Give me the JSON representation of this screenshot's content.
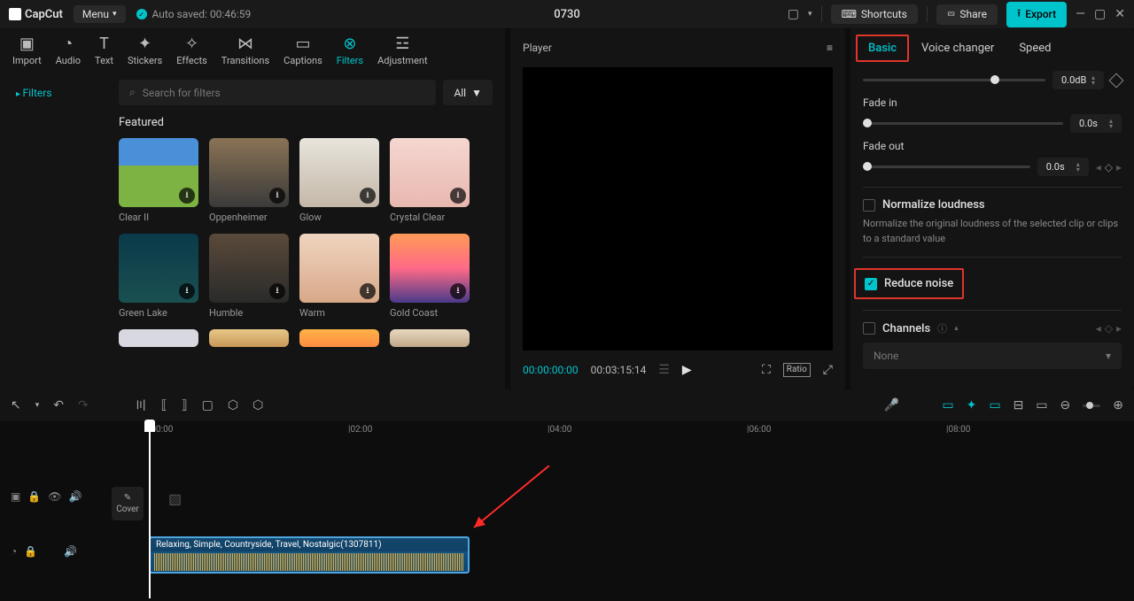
{
  "topbar": {
    "brand": "CapCut",
    "menu": "Menu",
    "autosave": "Auto saved: 00:46:59",
    "project": "0730",
    "shortcuts": "Shortcuts",
    "share": "Share",
    "export": "Export"
  },
  "media_tabs": {
    "import": "Import",
    "audio": "Audio",
    "text": "Text",
    "stickers": "Stickers",
    "effects": "Effects",
    "transitions": "Transitions",
    "captions": "Captions",
    "filters": "Filters",
    "adjustment": "Adjustment"
  },
  "filters_panel": {
    "sidebar_item": "Filters",
    "search_placeholder": "Search for filters",
    "all_btn": "All",
    "section": "Featured",
    "thumbs": [
      {
        "label": "Clear II"
      },
      {
        "label": "Oppenheimer"
      },
      {
        "label": "Glow"
      },
      {
        "label": "Crystal Clear"
      },
      {
        "label": "Green Lake"
      },
      {
        "label": "Humble"
      },
      {
        "label": "Warm"
      },
      {
        "label": "Gold Coast"
      }
    ]
  },
  "player": {
    "title": "Player",
    "time_current": "00:00:00:00",
    "time_total": "00:03:15:14",
    "ratio": "Ratio"
  },
  "right": {
    "tabs": {
      "basic": "Basic",
      "voice": "Voice changer",
      "speed": "Speed"
    },
    "db_val": "0.0dB",
    "fade_in_label": "Fade in",
    "fade_in_val": "0.0s",
    "fade_out_label": "Fade out",
    "fade_out_val": "0.0s",
    "normalize_label": "Normalize loudness",
    "normalize_desc": "Normalize the original loudness of the selected clip or clips to a standard value",
    "reduce_label": "Reduce noise",
    "channels_label": "Channels",
    "channels_value": "None"
  },
  "timeline": {
    "ticks": [
      "|00:00",
      "|02:00",
      "|04:00",
      "|06:00",
      "|08:00"
    ],
    "cover": "Cover",
    "clip_label": "Relaxing, Simple, Countryside, Travel, Nostalgic(1307811)"
  }
}
